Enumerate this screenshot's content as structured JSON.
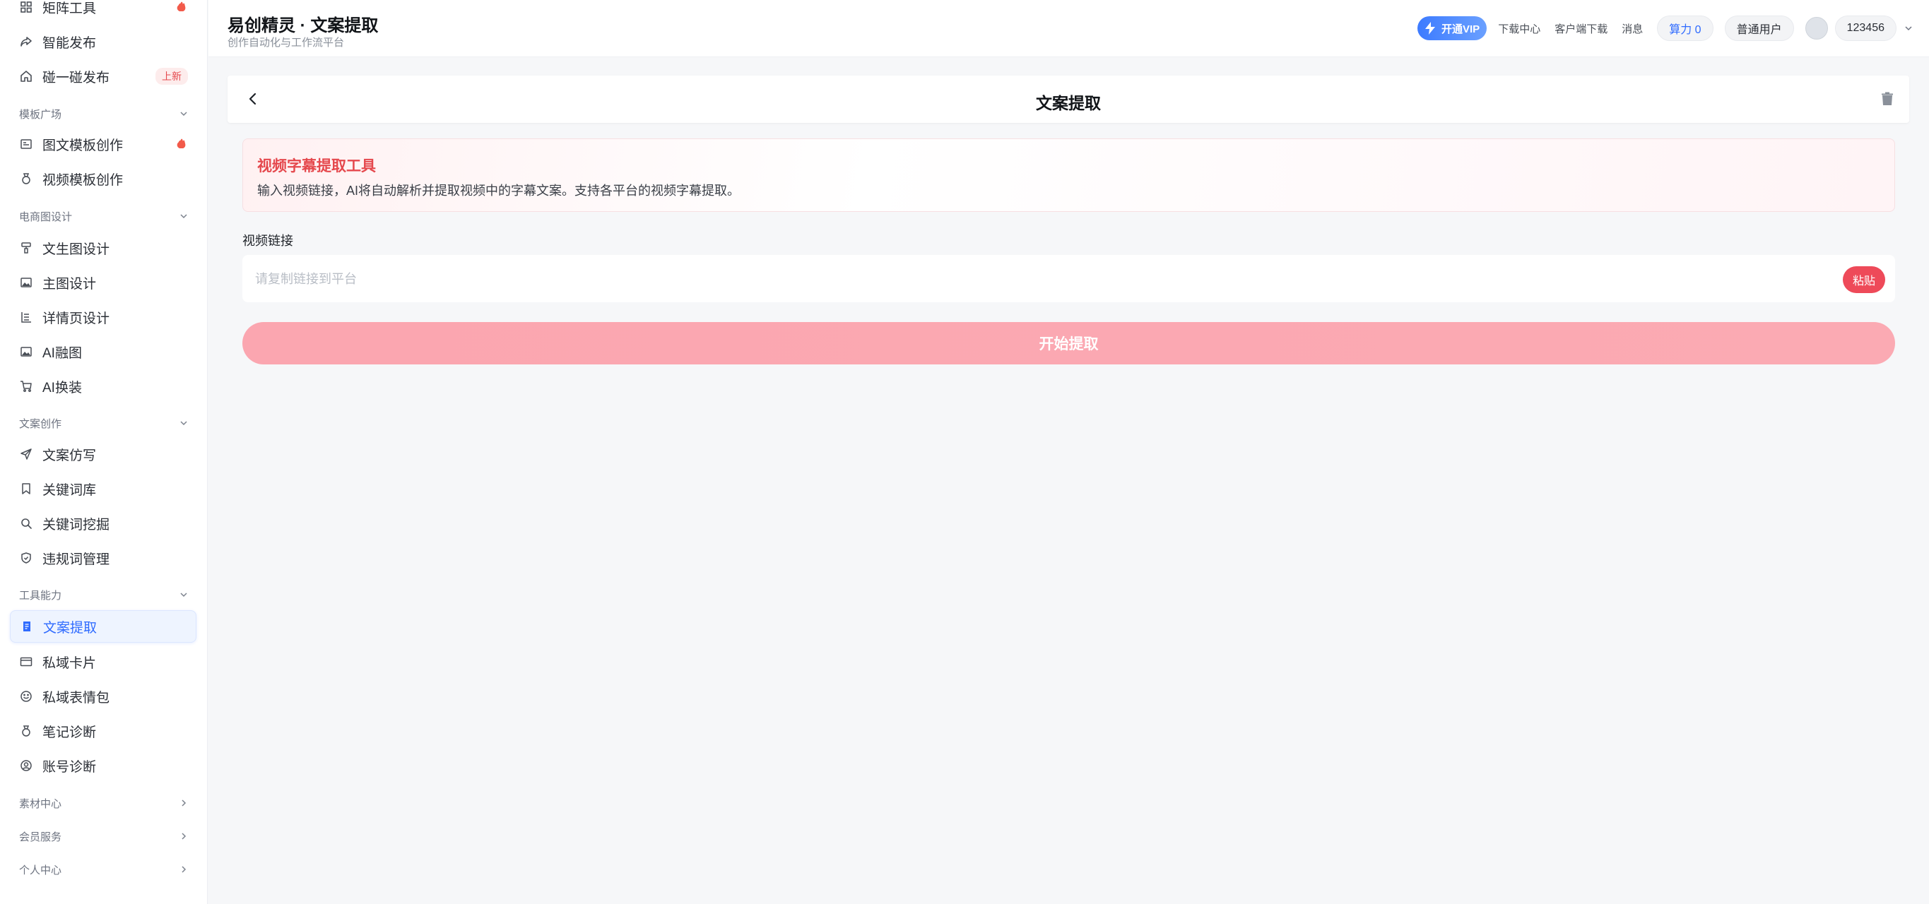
{
  "sidebar": {
    "items": [
      {
        "label": "矩阵工具",
        "icon": "grid-icon",
        "badge": "hot"
      },
      {
        "label": "智能发布",
        "icon": "share-arrow-icon"
      },
      {
        "label": "碰一碰发布",
        "icon": "home-icon",
        "badge_text": "上新"
      },
      {
        "label": "图文模板创作",
        "icon": "image-text-icon",
        "badge": "hot"
      },
      {
        "label": "视频模板创作",
        "icon": "medal-icon"
      },
      {
        "label": "文生图设计",
        "icon": "brush-icon"
      },
      {
        "label": "主图设计",
        "icon": "picture-icon"
      },
      {
        "label": "详情页设计",
        "icon": "layout-icon"
      },
      {
        "label": "AI融图",
        "icon": "picture-icon"
      },
      {
        "label": "AI换装",
        "icon": "cart-icon"
      },
      {
        "label": "文案仿写",
        "icon": "send-icon"
      },
      {
        "label": "关键词库",
        "icon": "bookmark-icon"
      },
      {
        "label": "关键词挖掘",
        "icon": "search-icon"
      },
      {
        "label": "违规词管理",
        "icon": "shield-icon"
      },
      {
        "label": "文案提取",
        "icon": "document-icon",
        "active": true
      },
      {
        "label": "私域卡片",
        "icon": "card-icon"
      },
      {
        "label": "私域表情包",
        "icon": "smile-icon"
      },
      {
        "label": "笔记诊断",
        "icon": "medal-icon"
      },
      {
        "label": "账号诊断",
        "icon": "user-circle-icon"
      }
    ],
    "groups": [
      {
        "label": "模板广场",
        "state": "expanded"
      },
      {
        "label": "电商图设计",
        "state": "expanded"
      },
      {
        "label": "文案创作",
        "state": "expanded"
      },
      {
        "label": "工具能力",
        "state": "expanded"
      },
      {
        "label": "素材中心",
        "state": "collapsed"
      },
      {
        "label": "会员服务",
        "state": "collapsed"
      },
      {
        "label": "个人中心",
        "state": "collapsed"
      }
    ]
  },
  "header": {
    "title": "易创精灵 · 文案提取",
    "subtitle": "创作自动化与工作流平台",
    "vip_label": "开通VIP",
    "download_center": "下载中心",
    "client_download": "客户端下载",
    "messages": "消息",
    "compute": "算力 0",
    "user_level": "普通用户",
    "username": "123456"
  },
  "page": {
    "title": "文案提取",
    "info_title": "视频字幕提取工具",
    "info_desc": "输入视频链接，AI将自动解析并提取视频中的字幕文案。支持各平台的视频字幕提取。",
    "field_label": "视频链接",
    "input_placeholder": "请复制链接到平台",
    "input_value": "",
    "paste_label": "粘贴",
    "start_label": "开始提取"
  },
  "colors": {
    "accent_blue": "#2f6bff",
    "brand_red": "#e5484d",
    "start_button": "#fba6b0"
  }
}
